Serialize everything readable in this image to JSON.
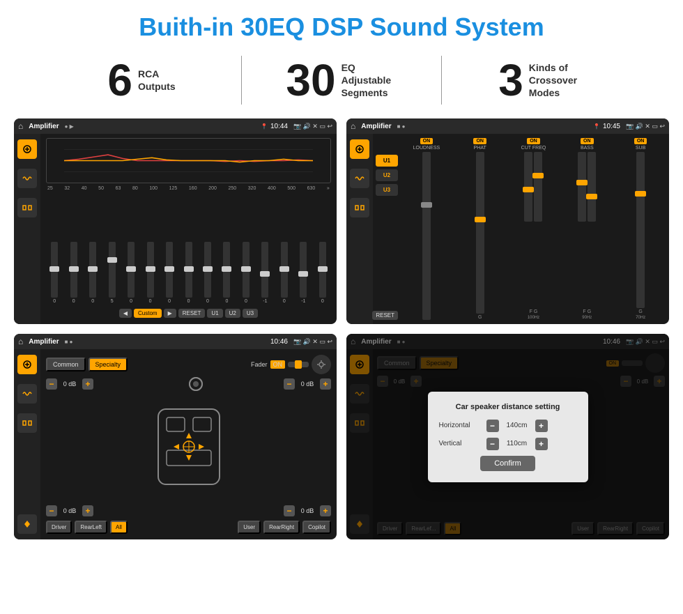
{
  "title": "Buith-in 30EQ DSP Sound System",
  "stats": [
    {
      "number": "6",
      "label": "RCA\nOutputs"
    },
    {
      "number": "30",
      "label": "EQ Adjustable\nSegments"
    },
    {
      "number": "3",
      "label": "Kinds of\nCrossover Modes"
    }
  ],
  "screens": [
    {
      "id": "eq-screen",
      "status_bar": {
        "app": "Amplifier",
        "time": "10:44"
      },
      "eq_freqs": [
        "25",
        "32",
        "40",
        "50",
        "63",
        "80",
        "100",
        "125",
        "160",
        "200",
        "250",
        "320",
        "400",
        "500",
        "630"
      ],
      "eq_values": [
        "0",
        "0",
        "0",
        "5",
        "0",
        "0",
        "0",
        "0",
        "0",
        "0",
        "0",
        "-1",
        "0",
        "-1",
        ""
      ],
      "bottom_btns": [
        "Custom",
        "RESET",
        "U1",
        "U2",
        "U3"
      ]
    },
    {
      "id": "crossover-screen",
      "status_bar": {
        "app": "Amplifier",
        "time": "10:45"
      },
      "presets": [
        "U1",
        "U2",
        "U3"
      ],
      "channels": [
        {
          "label": "LOUDNESS",
          "toggle": "ON"
        },
        {
          "label": "PHAT",
          "toggle": "ON"
        },
        {
          "label": "CUT FREQ",
          "toggle": "ON"
        },
        {
          "label": "BASS",
          "toggle": "ON"
        },
        {
          "label": "SUB",
          "toggle": "ON"
        }
      ],
      "reset_btn": "RESET"
    },
    {
      "id": "fader-screen",
      "status_bar": {
        "app": "Amplifier",
        "time": "10:46"
      },
      "tabs": [
        "Common",
        "Specialty"
      ],
      "fader_label": "Fader",
      "fader_on": "ON",
      "volumes": [
        {
          "label": "Driver",
          "val": "0 dB"
        },
        {
          "label": "Copilot",
          "val": "0 dB"
        },
        {
          "label": "RearLeft",
          "val": "0 dB"
        },
        {
          "label": "RearRight",
          "val": "0 dB"
        }
      ],
      "bottom_btns": [
        "Driver",
        "RearLeft",
        "All",
        "User",
        "RearRight",
        "Copilot"
      ]
    },
    {
      "id": "distance-screen",
      "status_bar": {
        "app": "Amplifier",
        "time": "10:46"
      },
      "tabs": [
        "Common",
        "Specialty"
      ],
      "dialog": {
        "title": "Car speaker distance setting",
        "horizontal_label": "Horizontal",
        "horizontal_value": "140cm",
        "vertical_label": "Vertical",
        "vertical_value": "110cm",
        "confirm_btn": "Confirm"
      },
      "side_volumes": [
        {
          "val": "0 dB"
        },
        {
          "val": "0 dB"
        }
      ],
      "bottom_btns": [
        "Driver",
        "RearLef...",
        "All",
        "User",
        "RearRight",
        "Copilot"
      ]
    }
  ]
}
